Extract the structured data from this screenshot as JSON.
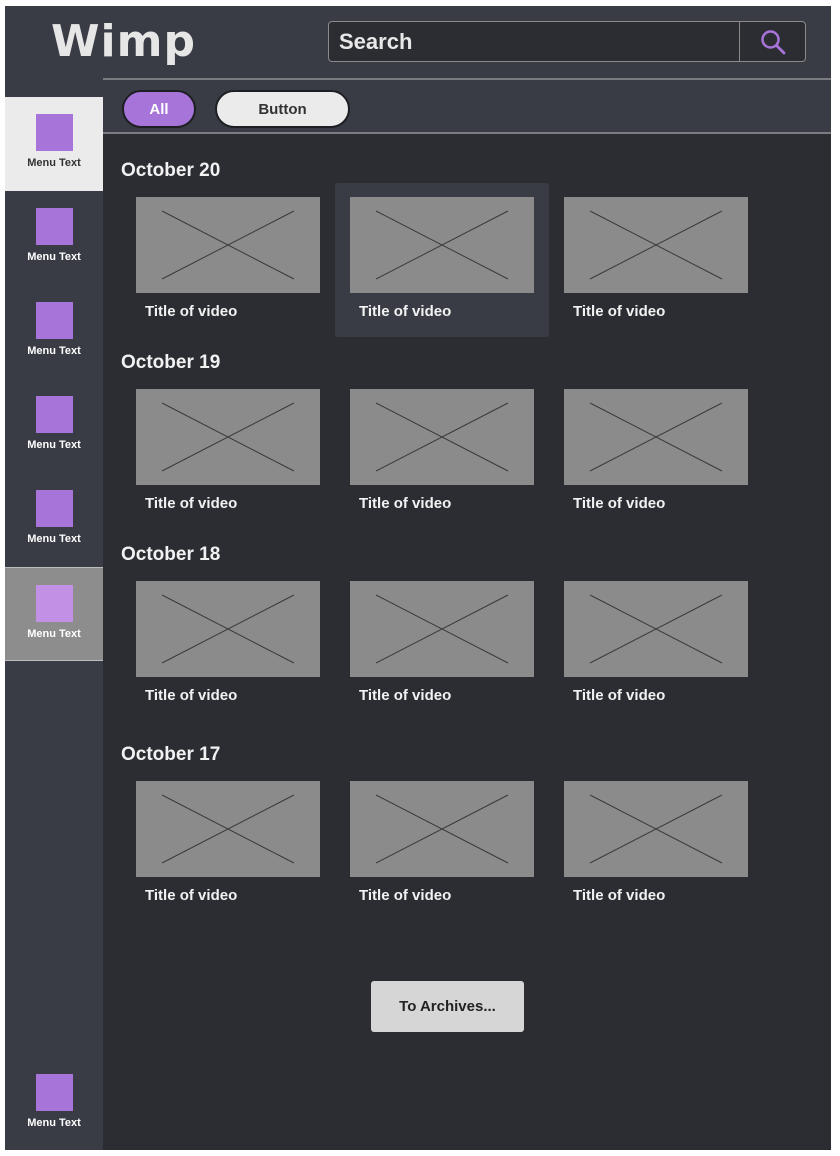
{
  "header": {
    "logo": "Wimp",
    "search_placeholder": "Search",
    "search_icon": "search-icon"
  },
  "filters": [
    {
      "label": "All",
      "selected": true
    },
    {
      "label": "Button",
      "selected": false
    }
  ],
  "sidebar": {
    "items": [
      {
        "label": "Menu Text",
        "state": "active"
      },
      {
        "label": "Menu Text",
        "state": "normal"
      },
      {
        "label": "Menu Text",
        "state": "normal"
      },
      {
        "label": "Menu Text",
        "state": "normal"
      },
      {
        "label": "Menu Text",
        "state": "normal"
      },
      {
        "label": "Menu Text",
        "state": "hover"
      }
    ],
    "bottom_item": {
      "label": "Menu Text"
    }
  },
  "sections": [
    {
      "date": "October 20",
      "videos": [
        {
          "title": "Title of video"
        },
        {
          "title": "Title of video"
        },
        {
          "title": "Title of video"
        }
      ]
    },
    {
      "date": "October 19",
      "videos": [
        {
          "title": "Title of video"
        },
        {
          "title": "Title of video"
        },
        {
          "title": "Title of video"
        }
      ]
    },
    {
      "date": "October 18",
      "videos": [
        {
          "title": "Title of video"
        },
        {
          "title": "Title of video"
        },
        {
          "title": "Title of video"
        }
      ]
    },
    {
      "date": "October 17",
      "videos": [
        {
          "title": "Title of video"
        },
        {
          "title": "Title of video"
        },
        {
          "title": "Title of video"
        }
      ]
    }
  ],
  "archives_button": "To Archives...",
  "colors": {
    "accent": "#a774da",
    "background": "#2b2d33",
    "panel": "#393c44",
    "thumbnail": "#8b8b8b"
  }
}
